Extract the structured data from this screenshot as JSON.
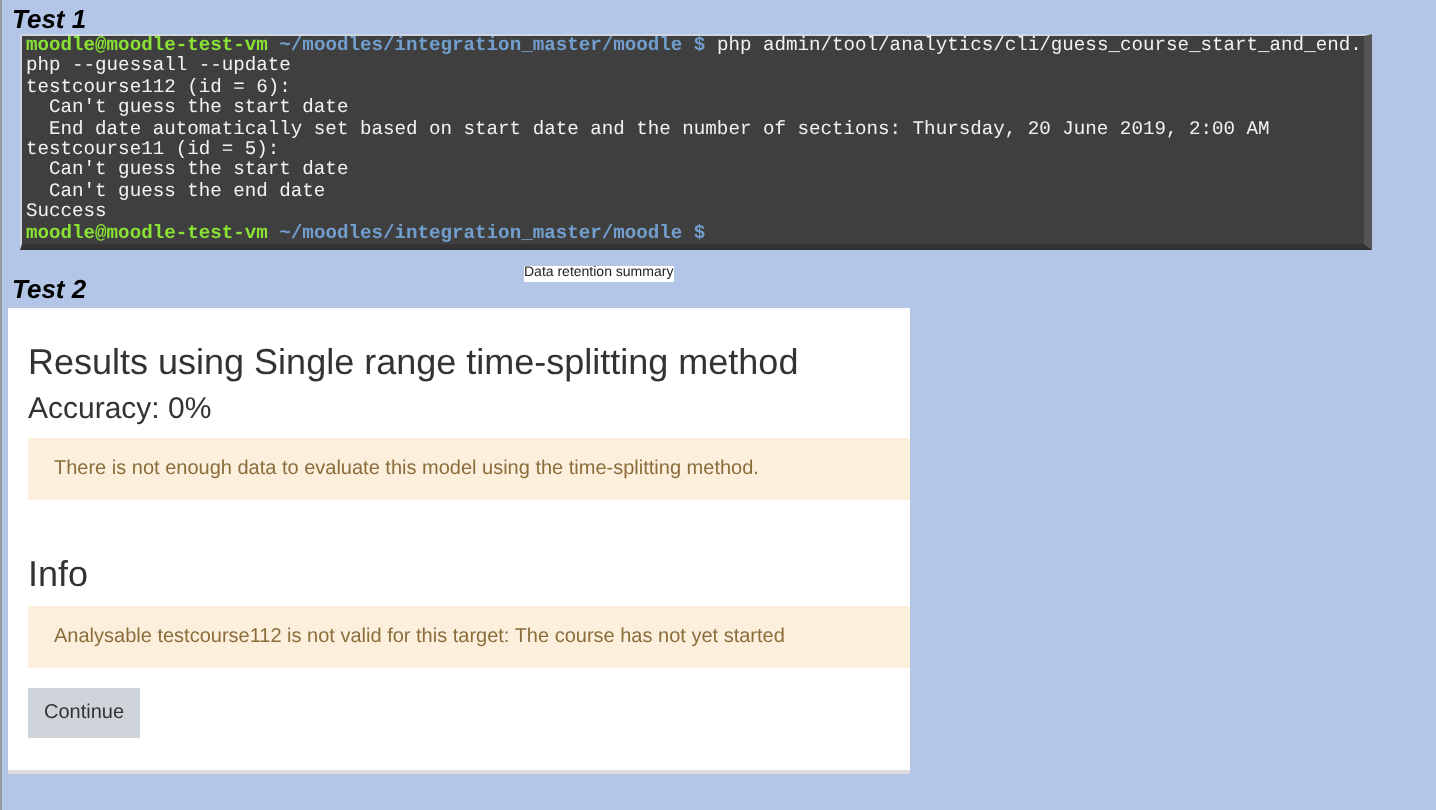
{
  "test1": {
    "label": "Test 1",
    "terminal": {
      "lines": [
        {
          "kind": "prompt",
          "user": "moodle@moodle-test-vm",
          "path": "~/moodles/integration_master/moodle $",
          "command": "php admin/tool/analytics/cli/guess_course_start_and_end."
        },
        {
          "kind": "output",
          "text": "php --guessall --update"
        },
        {
          "kind": "output",
          "text": "testcourse112 (id = 6):"
        },
        {
          "kind": "output",
          "text": "  Can't guess the start date"
        },
        {
          "kind": "output",
          "text": "  End date automatically set based on start date and the number of sections: Thursday, 20 June 2019, 2:00 AM"
        },
        {
          "kind": "output",
          "text": "testcourse11 (id = 5):"
        },
        {
          "kind": "output",
          "text": "  Can't guess the start date"
        },
        {
          "kind": "output",
          "text": "  Can't guess the end date"
        },
        {
          "kind": "output",
          "text": "Success"
        },
        {
          "kind": "prompt",
          "user": "moodle@moodle-test-vm",
          "path": "~/moodles/integration_master/moodle $"
        }
      ]
    },
    "below": "Data retention summary"
  },
  "test2": {
    "label": "Test 2",
    "heading": "Results using Single range time-splitting method",
    "accuracy": "Accuracy: 0%",
    "alert": "There is not enough data to evaluate this model using the time-splitting method.",
    "info_heading": "Info",
    "info_alert": "Analysable testcourse112 is not valid for this target: The course has not yet started",
    "button": "Continue"
  }
}
